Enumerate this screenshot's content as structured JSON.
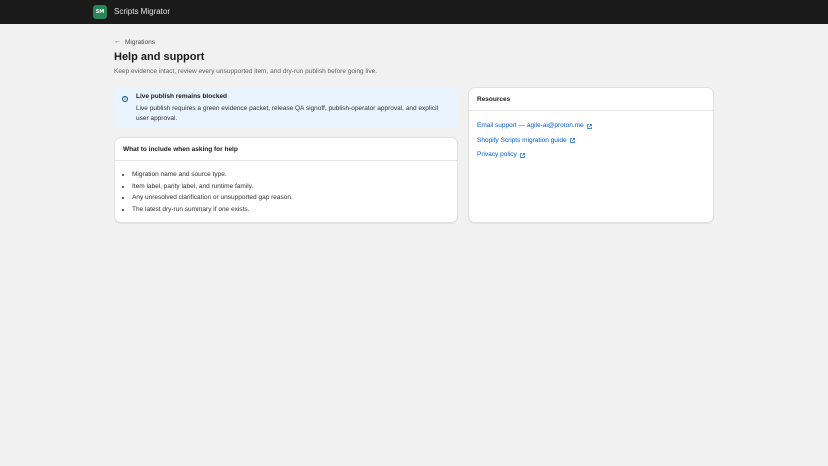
{
  "topbar": {
    "logo_text": "SM",
    "app_name": "Scripts Migrator"
  },
  "breadcrumb": {
    "arrow": "←",
    "label": "Migrations"
  },
  "page": {
    "title": "Help and support",
    "subtitle": "Keep evidence intact, review every unsupported item, and dry-run publish before going live."
  },
  "banner": {
    "icon": "info-icon",
    "title": "Live publish remains blocked",
    "body": "Live publish requires a green evidence packet, release QA signoff, publish-operator approval, and explicit user approval."
  },
  "help_card": {
    "title": "What to include when asking for help",
    "items": [
      "Migration name and source type.",
      "Item label, parity label, and runtime family.",
      "Any unresolved clarification or unsupported gap reason.",
      "The latest dry-run summary if one exists."
    ]
  },
  "resources": {
    "title": "Resources",
    "links": [
      {
        "label": "Email support — agile-ai@proton.me",
        "icon": "external-link-icon"
      },
      {
        "label": "Shopify Scripts migration guide",
        "icon": "external-link-icon"
      },
      {
        "label": "Privacy policy",
        "icon": "external-link-icon"
      }
    ]
  },
  "colors": {
    "topbar": "#1a1a1a",
    "logo": "#29845a",
    "banner_bg": "#eaf4ff",
    "link": "#005bd3",
    "page_bg": "#f1f1f1"
  }
}
